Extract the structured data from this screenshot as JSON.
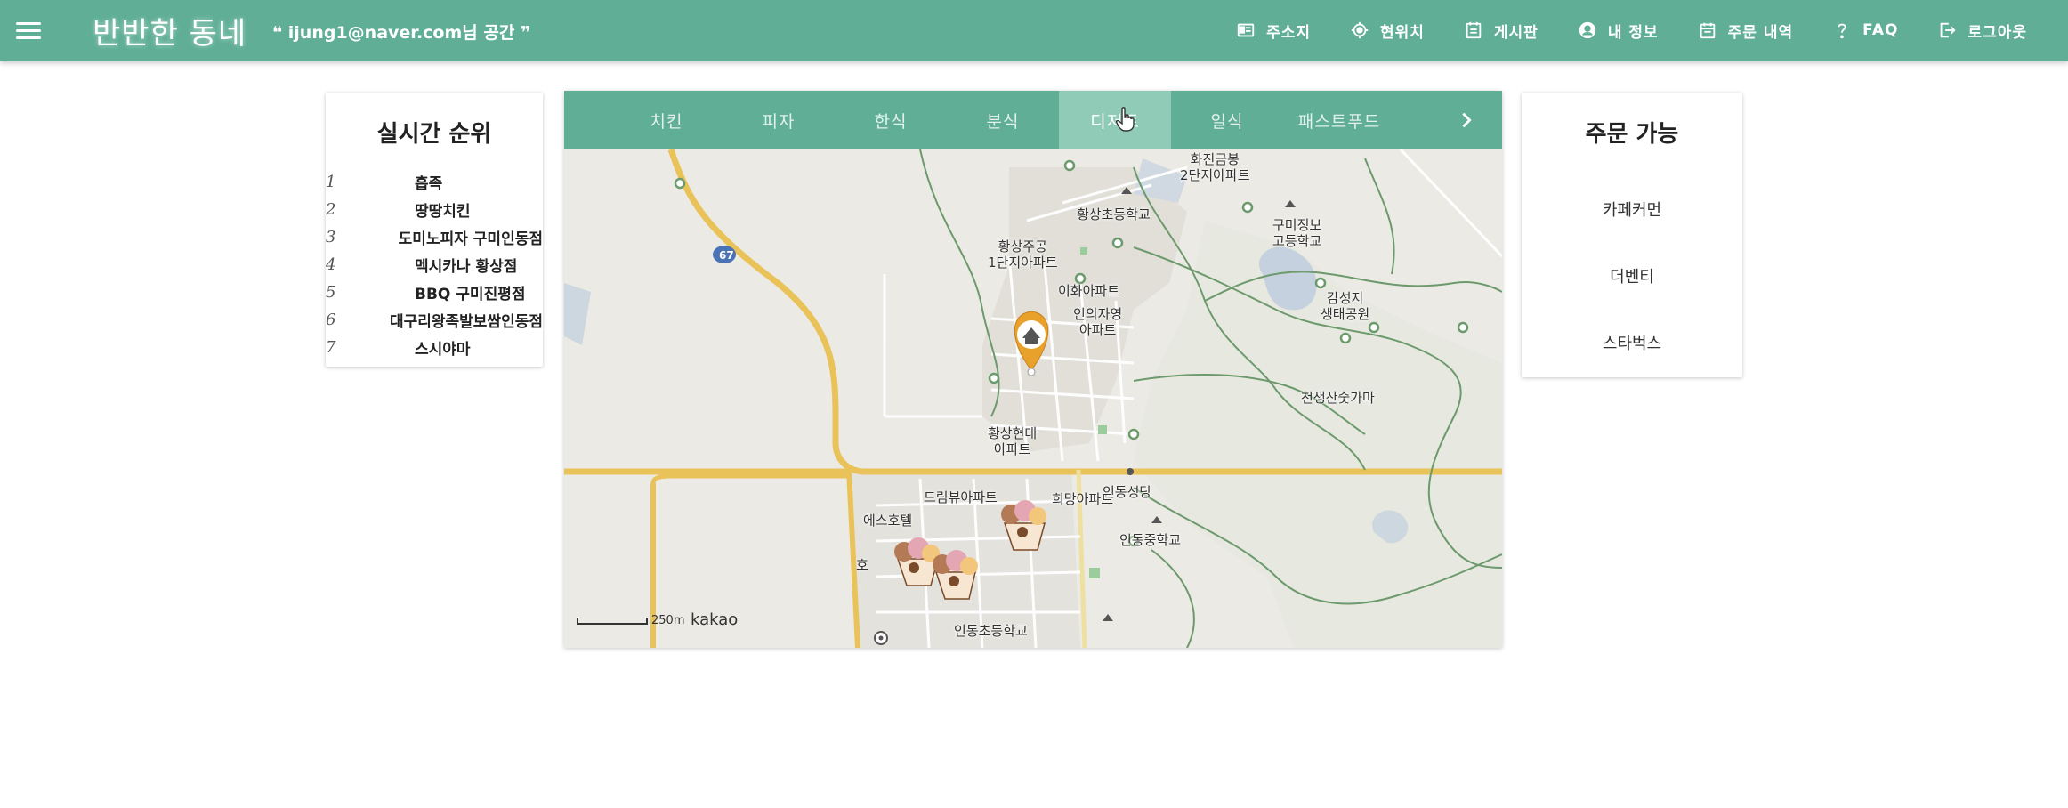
{
  "header": {
    "brand": "반반한 동네",
    "user_space": "❝ ijung1@naver.com님 공간 ❞",
    "nav": [
      {
        "label": "주소지",
        "icon": "address-card-icon"
      },
      {
        "label": "현위치",
        "icon": "location-target-icon"
      },
      {
        "label": "게시판",
        "icon": "board-icon"
      },
      {
        "label": "내 정보",
        "icon": "account-icon"
      },
      {
        "label": "주문 내역",
        "icon": "calendar-icon"
      },
      {
        "label": "FAQ",
        "icon": "question-icon"
      },
      {
        "label": "로그아웃",
        "icon": "logout-icon"
      }
    ]
  },
  "ranking": {
    "title": "실시간 순위",
    "items": [
      {
        "rank": "1",
        "name": "흡족"
      },
      {
        "rank": "2",
        "name": "땅땅치킨"
      },
      {
        "rank": "3",
        "name": "도미노피자 구미인동점"
      },
      {
        "rank": "4",
        "name": "멕시카나 황상점"
      },
      {
        "rank": "5",
        "name": "BBQ 구미진평점"
      },
      {
        "rank": "6",
        "name": "대구리왕족발보쌈인동점"
      },
      {
        "rank": "7",
        "name": "스시야마"
      }
    ]
  },
  "categories": {
    "tabs": [
      "치킨",
      "피자",
      "한식",
      "분식",
      "디저트",
      "일식",
      "패스트푸드"
    ],
    "active": "디저트"
  },
  "map": {
    "labels": {
      "apt1": "화진금봉\n2단지아파트",
      "school1": "황상초등학교",
      "apt2": "황상주공\n1단지아파트",
      "school2": "구미정보\n고등학교",
      "apt3": "이화아파트",
      "apt4": "인의자영\n아파트",
      "park": "감성지\n생태공원",
      "kiln": "천생산숯가마",
      "apt5": "황상현대\n아파트",
      "church": "인동성당",
      "apt6": "드림뷰아파트",
      "apt7": "희망아파트",
      "hotel": "에스호텔",
      "school3": "인동중학교",
      "school4": "인동초등학교",
      "road": "67",
      "hotel2": "호"
    },
    "scale": "250m",
    "provider": "kakao"
  },
  "available": {
    "title": "주문 가능",
    "items": [
      "카페커먼",
      "더벤티",
      "스타벅스"
    ]
  },
  "colors": {
    "primary": "#5fae95",
    "tab_active": "#8fcbb6",
    "highlight": "#6ed07a",
    "marker": "#e8a22c"
  }
}
